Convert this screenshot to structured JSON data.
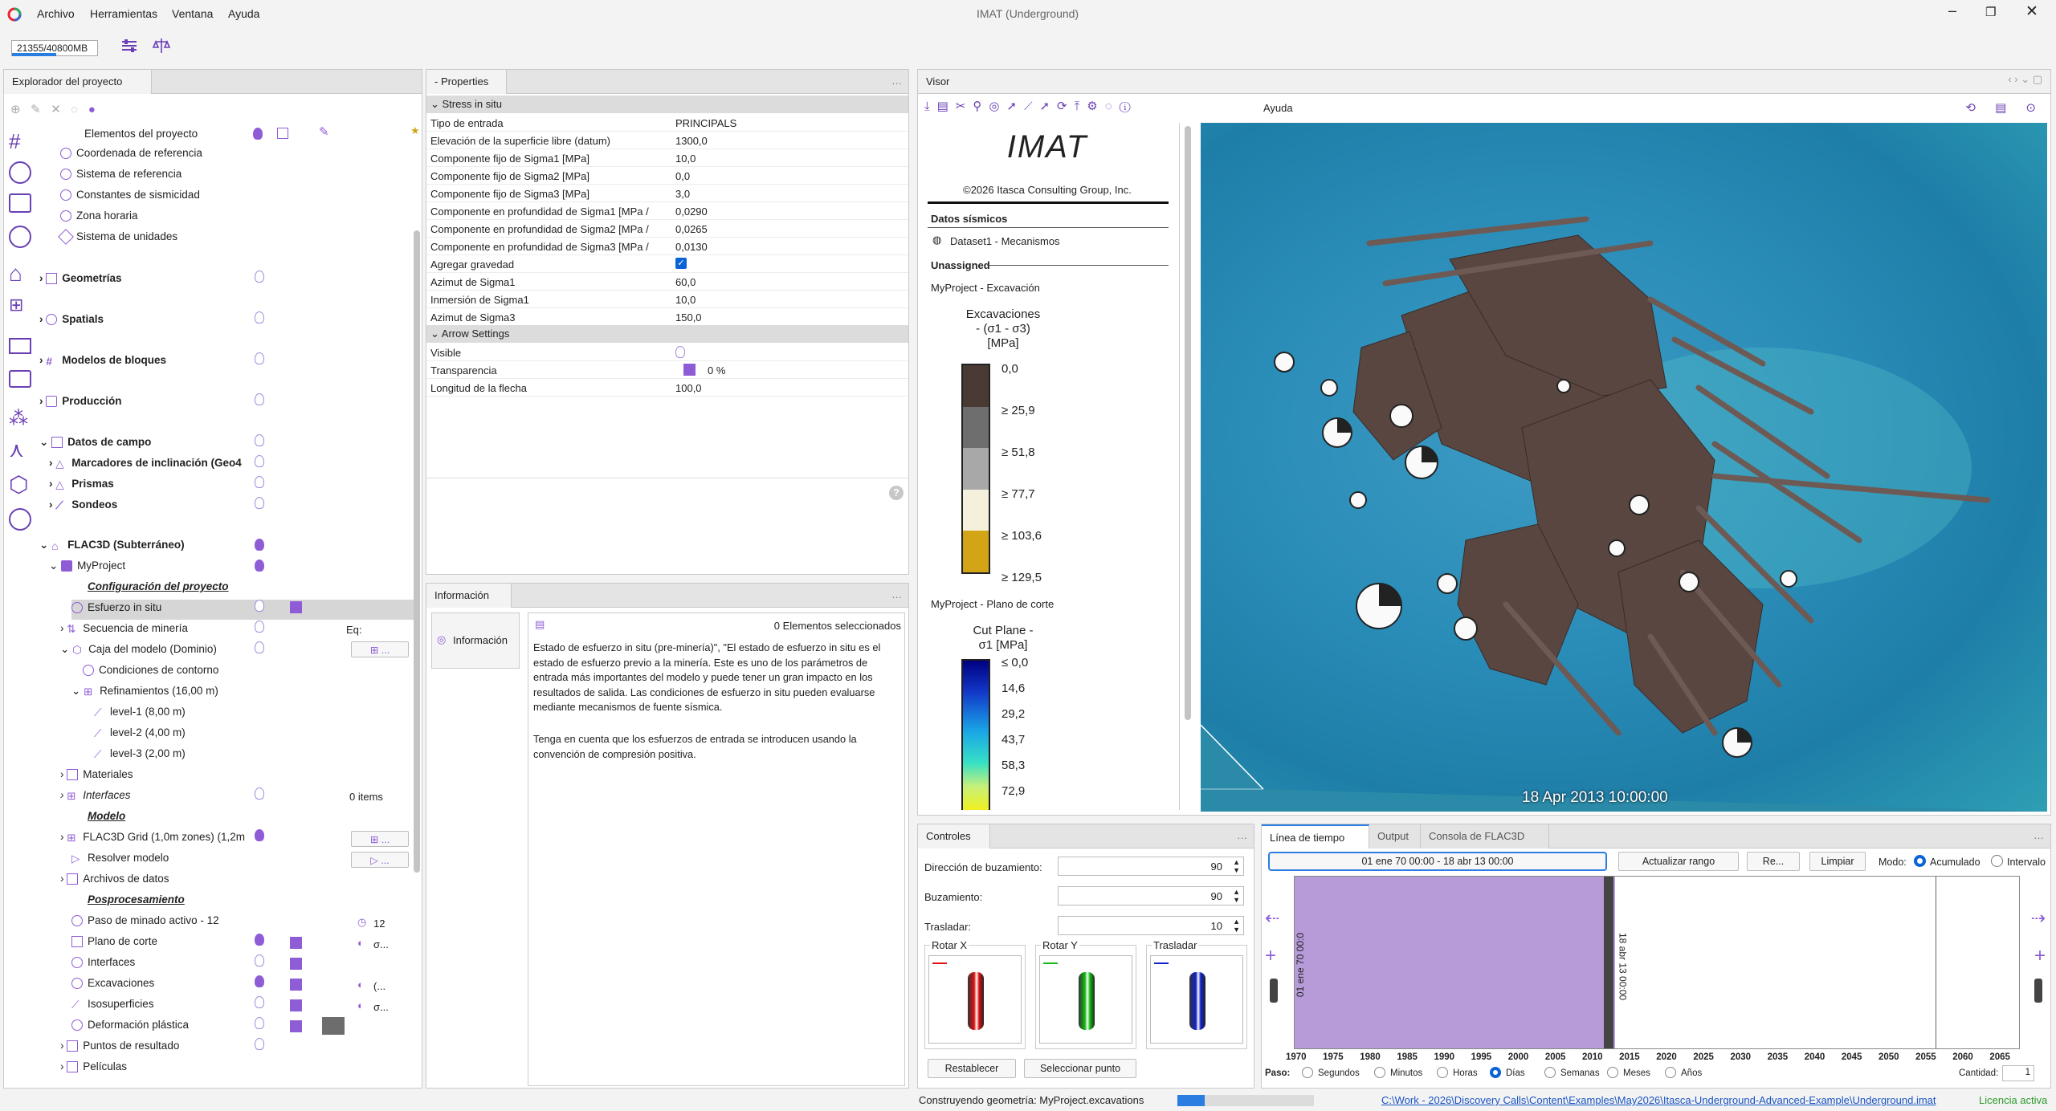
{
  "app": {
    "window_title": "IMAT (Underground)",
    "menu": [
      "Archivo",
      "Herramientas",
      "Ventana",
      "Ayuda"
    ],
    "memory": "21355/40800MB",
    "memory_fraction": 0.523
  },
  "explorer": {
    "title": "Explorador del proyecto",
    "header": "Elementos del proyecto",
    "items": [
      {
        "label": "Coordenada de referencia",
        "bold": false
      },
      {
        "label": "Sistema de referencia",
        "bold": false
      },
      {
        "label": "Constantes de sismicidad",
        "bold": false
      },
      {
        "label": "Zona horaria",
        "bold": false
      },
      {
        "label": "Sistema de unidades",
        "bold": false
      },
      {
        "label": "Geometrías",
        "bold": true
      },
      {
        "label": "Spatials",
        "bold": true
      },
      {
        "label": "Modelos de bloques",
        "bold": true
      },
      {
        "label": "Producción",
        "bold": true
      },
      {
        "label": "Datos de campo",
        "bold": true
      },
      {
        "label": "Marcadores de inclinación (Geo4",
        "bold": true
      },
      {
        "label": "Prismas",
        "bold": true
      },
      {
        "label": "Sondeos",
        "bold": true
      },
      {
        "label": "FLAC3D (Subterráneo)",
        "bold": true
      },
      {
        "label": "MyProject",
        "bold": false
      },
      {
        "label": "Configuración del proyecto",
        "bold": true
      },
      {
        "label": "Esfuerzo in situ",
        "bold": false
      },
      {
        "label": "Secuencia de minería",
        "bold": false
      },
      {
        "label": "Caja del modelo (Dominio)",
        "bold": false
      },
      {
        "label": "Condiciones de contorno",
        "bold": false
      },
      {
        "label": "Refinamientos (16,00 m)",
        "bold": false
      },
      {
        "label": "level-1 (8,00 m)",
        "bold": false
      },
      {
        "label": "level-2 (4,00 m)",
        "bold": false
      },
      {
        "label": "level-3 (2,00 m)",
        "bold": false
      },
      {
        "label": "Materiales",
        "bold": false
      },
      {
        "label": "Interfaces",
        "bold": false
      },
      {
        "label": "Modelo",
        "bold": true
      },
      {
        "label": "FLAC3D Grid (1,0m zones) (1,2m",
        "bold": false
      },
      {
        "label": "Resolver modelo",
        "bold": false
      },
      {
        "label": "Archivos de datos",
        "bold": false
      },
      {
        "label": "Posprocesamiento",
        "bold": true
      },
      {
        "label": "Paso de minado activo - 12",
        "bold": false
      },
      {
        "label": "Plano de corte",
        "bold": false
      },
      {
        "label": "Interfaces",
        "bold": false
      },
      {
        "label": "Excavaciones",
        "bold": false
      },
      {
        "label": "Isosuperficies",
        "bold": false
      },
      {
        "label": "Deformación plástica",
        "bold": false
      },
      {
        "label": "Puntos de resultado",
        "bold": false
      },
      {
        "label": "Películas",
        "bold": false
      }
    ],
    "extras": {
      "eq": "Eq:",
      "items_count": "0 items",
      "step_value": "12",
      "cut_value": "σ...",
      "exc_value": "(...",
      "iso_value": "σ..."
    }
  },
  "properties": {
    "title": "- Properties",
    "section1": "Stress in situ",
    "rows": [
      {
        "k": "Tipo de entrada",
        "v": "PRINCIPALS"
      },
      {
        "k": "Elevación de la superficie libre (datum)",
        "v": "1300,0"
      },
      {
        "k": "Componente fijo de Sigma1 [MPa]",
        "v": "10,0"
      },
      {
        "k": "Componente fijo de Sigma2 [MPa]",
        "v": "0,0"
      },
      {
        "k": "Componente fijo de Sigma3 [MPa]",
        "v": "3,0"
      },
      {
        "k": "Componente en profundidad de Sigma1 [MPa /",
        "v": "0,0290"
      },
      {
        "k": "Componente en profundidad de Sigma2 [MPa /",
        "v": "0,0265"
      },
      {
        "k": "Componente en profundidad de Sigma3 [MPa /",
        "v": "0,0130"
      },
      {
        "k": "Agregar gravedad",
        "v": ""
      },
      {
        "k": "Azimut de Sigma1",
        "v": "60,0"
      },
      {
        "k": "Inmersión de Sigma1",
        "v": "10,0"
      },
      {
        "k": "Azimut de Sigma3",
        "v": "150,0"
      }
    ],
    "section2": "Arrow Settings",
    "rows2": [
      {
        "k": "Visible",
        "v": ""
      },
      {
        "k": "Transparencia",
        "v": "0 %"
      },
      {
        "k": "Longitud de la flecha",
        "v": "100,0"
      }
    ]
  },
  "info": {
    "title": "Información",
    "tab": "Información",
    "selected": "0 Elementos seleccionados",
    "para1": "Estado de esfuerzo in situ (pre-minería)\", \"El estado de esfuerzo in situ es el estado de esfuerzo previo a la minería. Este es uno de los parámetros de entrada más importantes del modelo y puede tener un gran impacto en los resultados de salida. Las condiciones de esfuerzo in situ pueden evaluarse mediante mecanismos de fuente sísmica.",
    "para2": "Tenga en cuenta que los esfuerzos de entrada se introducen usando la convención de compresión positiva."
  },
  "viewer": {
    "title": "Visor",
    "help": "Ayuda",
    "logo": "IMAT",
    "copyright": "©2026 Itasca Consulting Group, Inc.",
    "seismic_header": "Datos sísmicos",
    "dataset": "Dataset1 - Mecanismos",
    "unassigned": "Unassigned",
    "legend1_group": "MyProject - Excavación",
    "legend1_title": [
      "Excavaciones",
      "- (σ1 - σ3)",
      "[MPa]"
    ],
    "legend1_ticks": [
      "0,0",
      "≥ 25,9",
      "≥ 51,8",
      "≥ 77,7",
      "≥ 103,6",
      "≥ 129,5"
    ],
    "legend1_colors": [
      "#4a3a34",
      "#6e6e6e",
      "#a8a8a8",
      "#f5f0dc",
      "#d4a417"
    ],
    "legend2_group": "MyProject - Plano de corte",
    "legend2_title": [
      "Cut Plane -",
      "σ1 [MPa]"
    ],
    "legend2_ticks": [
      "≤ 0,0",
      "14,6",
      "29,2",
      "43,7",
      "58,3",
      "72,9"
    ],
    "timestamp": "18 Apr 2013 10:00:00"
  },
  "controls": {
    "title": "Controles",
    "fields": [
      {
        "label": "Dirección de buzamiento:",
        "value": "90"
      },
      {
        "label": "Buzamiento:",
        "value": "90"
      },
      {
        "label": "Trasladar:",
        "value": "10"
      }
    ],
    "wheels": [
      "Rotar X",
      "Rotar Y",
      "Trasladar"
    ],
    "wheel_colors": [
      "#d11",
      "#1b1",
      "#12c"
    ],
    "reset": "Restablecer",
    "select_point": "Seleccionar punto"
  },
  "timeline": {
    "tabs": [
      "Línea de tiempo",
      "Output",
      "Consola de FLAC3D"
    ],
    "range": "01 ene 70 00:00 - 18 abr 13 00:00",
    "update": "Actualizar rango",
    "re": "Re...",
    "clear": "Limpiar",
    "mode_label": "Modo:",
    "mode_opts": [
      "Acumulado",
      "Intervalo"
    ],
    "years": [
      "1970",
      "1975",
      "1980",
      "1985",
      "1990",
      "1995",
      "2000",
      "2005",
      "2010",
      "2015",
      "2020",
      "2025",
      "2030",
      "2035",
      "2040",
      "2045",
      "2050",
      "2055",
      "2060",
      "2065"
    ],
    "marker_label": "18 abr 13 00:00",
    "start_label": "01 ene 70 00:0",
    "step_label": "Paso:",
    "step_opts": [
      "Segundos",
      "Minutos",
      "Horas",
      "Días",
      "Semanas",
      "Meses",
      "Años"
    ],
    "step_selected": 3,
    "qty_label": "Cantidad:",
    "qty": "1"
  },
  "status": {
    "text": "Construyendo geometría: MyProject.excavations",
    "progress": 0.2,
    "path": "C:\\Work - 2026\\Discovery Calls\\Content\\Examples\\May2026\\Itasca-Underground-Advanced-Example\\Underground.imat",
    "license": "Licencia activa"
  }
}
